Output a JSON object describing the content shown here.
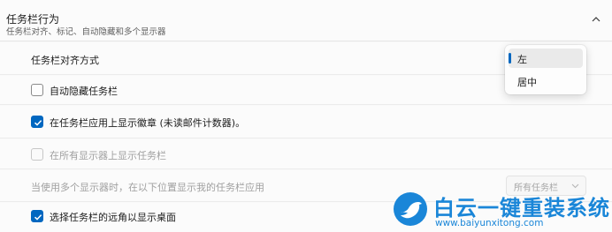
{
  "section": {
    "title": "任务栏行为",
    "subtitle": "任务栏对齐、标记、自动隐藏和多个显示器"
  },
  "alignment": {
    "label": "任务栏对齐方式",
    "options": [
      {
        "label": "左",
        "selected": true
      },
      {
        "label": "居中",
        "selected": false
      }
    ]
  },
  "auto_hide": {
    "label": "自动隐藏任务栏",
    "checked": false
  },
  "badges": {
    "label": "在任务栏应用上显示徽章 (未读邮件计数器)。",
    "checked": true
  },
  "all_displays": {
    "label": "在所有显示器上显示任务栏",
    "checked": false,
    "disabled": true
  },
  "multi_display": {
    "label": "当使用多个显示器时，在以下位置显示我的任务栏应用",
    "select_value": "所有任务栏",
    "disabled": true
  },
  "far_corner": {
    "label": "选择任务栏的远角以显示桌面",
    "checked": true
  },
  "watermark": {
    "text": "白云一键重装系统",
    "url": "www.baiyunxitong.com"
  },
  "colors": {
    "accent": "#0067c0",
    "watermark": "#1a86d8"
  }
}
